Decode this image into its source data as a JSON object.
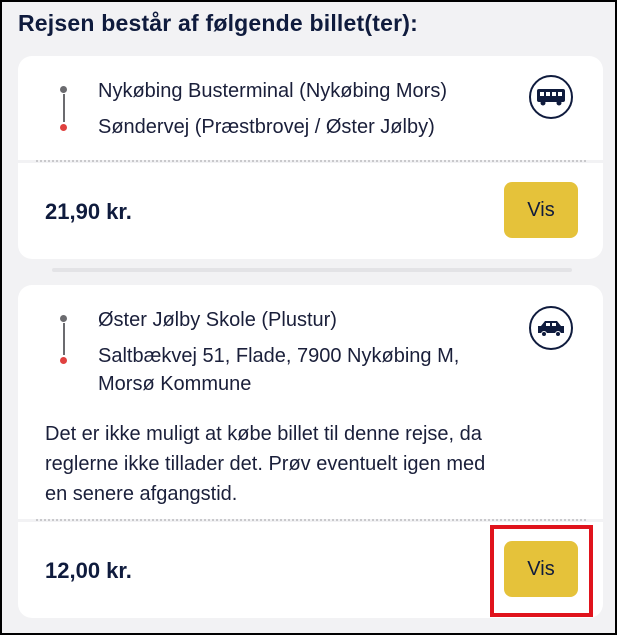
{
  "header": {
    "title": "Rejsen består af følgende billet(ter):"
  },
  "tickets": [
    {
      "from": "Nykøbing Busterminal (Nykøbing Mors)",
      "to": "Søndervej (Præstbrovej / Øster Jølby)",
      "icon": "bus-icon",
      "price": "21,90  kr.",
      "button": "Vis"
    },
    {
      "from": "Øster Jølby Skole (Plustur)",
      "to_line1": "Saltbækvej 51, Flade, 7900 Nykøbing M,",
      "to_line2": "Morsø Kommune",
      "icon": "car-icon",
      "note": [
        "Det er ikke muligt at købe billet til denne rejse, da",
        "reglerne ikke tillader det. Prøv eventuelt igen med",
        "en senere afgangstid."
      ],
      "price": "12,00  kr.",
      "button": "Vis"
    }
  ],
  "colors": {
    "accent_button": "#e5c23a",
    "text": "#0f1b3d",
    "stop_dot": "#e0413f",
    "highlight": "#e0131c"
  }
}
